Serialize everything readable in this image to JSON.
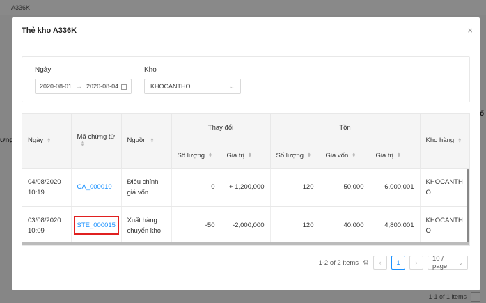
{
  "background": {
    "top_title": "A336K",
    "side_text_1": "ưng",
    "side_text_2": "ố",
    "pagination_text": "1-1 of 1 items"
  },
  "modal": {
    "title": "Thẻ kho A336K",
    "close_icon": "×"
  },
  "filter": {
    "date_label": "Ngày",
    "date_from": "2020-08-01",
    "date_arrow": "→",
    "date_to": "2020-08-04",
    "warehouse_label": "Kho",
    "warehouse_value": "KHOCANTHO"
  },
  "table": {
    "headers": {
      "date": "Ngày",
      "voucher": "Mã chứng từ",
      "source": "Nguồn",
      "change": "Thay đổi",
      "stock": "Tồn",
      "warehouse": "Kho hàng",
      "change_qty": "Số lượng",
      "change_value": "Giá trị",
      "stock_qty": "Số lượng",
      "stock_cost": "Giá vốn",
      "stock_value": "Giá trị"
    },
    "rows": [
      {
        "date": "04/08/2020",
        "time": "10:19",
        "voucher": "CA_000010",
        "source_1": "Điều chỉnh",
        "source_2": "giá vốn",
        "change_qty": "0",
        "change_value": "+ 1,200,000",
        "stock_qty": "120",
        "stock_cost": "50,000",
        "stock_value": "6,000,001",
        "warehouse_1": "KHOCANTH",
        "warehouse_2": "O"
      },
      {
        "date": "03/08/2020",
        "time": "10:09",
        "voucher": "STE_000015",
        "source_1": "Xuất hàng",
        "source_2": "chuyển kho",
        "change_qty": "-50",
        "change_value": "-2,000,000",
        "stock_qty": "120",
        "stock_cost": "40,000",
        "stock_value": "4,800,001",
        "warehouse_1": "KHOCANTH",
        "warehouse_2": "O"
      }
    ]
  },
  "pagination": {
    "summary": "1-2 of 2 items",
    "current_page": "1",
    "page_size": "10 / page"
  },
  "colors": {
    "link": "#1890ff",
    "highlight_border": "#e02020"
  }
}
